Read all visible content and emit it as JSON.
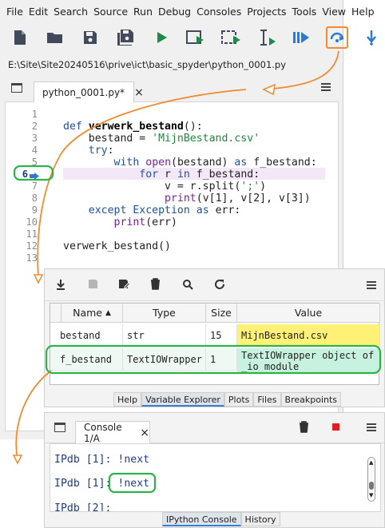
{
  "menubar": {
    "items": [
      "File",
      "Edit",
      "Search",
      "Source",
      "Run",
      "Debug",
      "Consoles",
      "Projects",
      "Tools",
      "View",
      "Help"
    ]
  },
  "toolbar": {
    "icons": [
      "new-file-icon",
      "open-folder-icon",
      "save-icon",
      "save-all-icon",
      "run-icon",
      "run-cell-icon",
      "run-cell-advance-icon",
      "run-selection-icon",
      "debug-icon",
      "step-over-icon",
      "step-into-icon"
    ]
  },
  "path": {
    "text": "E:\\Site\\Site20240516\\prive\\ict\\basic_spyder\\python_0001.py"
  },
  "editor": {
    "tab_label": "python_0001.py*",
    "tab_close": "×",
    "current_line": "6",
    "lines": [
      {
        "n": "1",
        "code": ""
      },
      {
        "n": "2",
        "code": "def verwerk_bestand():"
      },
      {
        "n": "3",
        "code": "    bestand = 'MijnBestand.csv'"
      },
      {
        "n": "4",
        "code": "    try:"
      },
      {
        "n": "5",
        "code": "        with open(bestand) as f_bestand:"
      },
      {
        "n": "6",
        "code": "            for r in f_bestand:"
      },
      {
        "n": "7",
        "code": "                v = r.split(';')"
      },
      {
        "n": "8",
        "code": "                print(v[1], v[2], v[3])"
      },
      {
        "n": "9",
        "code": "    except Exception as err:"
      },
      {
        "n": "10",
        "code": "        print(err)"
      },
      {
        "n": "11",
        "code": ""
      },
      {
        "n": "12",
        "code": "verwerk_bestand()"
      },
      {
        "n": "13",
        "code": ""
      }
    ]
  },
  "variable_explorer": {
    "columns": [
      "Name",
      "Type",
      "Size",
      "Value"
    ],
    "sort_arrow": "▲",
    "rows": [
      {
        "name": "bestand",
        "type": "str",
        "size": "15",
        "value": "MijnBestand.csv",
        "color": "#fff176"
      },
      {
        "name": "f_bestand",
        "type": "TextIOWrapper",
        "size": "1",
        "value": "TextIOWrapper object of _io module",
        "value_l1": "TextIOWrapper object of",
        "value_l2": "_io module",
        "color": "#e8e8e8"
      }
    ],
    "tabs": [
      "Help",
      "Variable Explorer",
      "Plots",
      "Files",
      "Breakpoints"
    ],
    "active_tab": "Variable Explorer"
  },
  "console": {
    "tab_label": "Console 1/A",
    "tab_close": "×",
    "lines": [
      {
        "prompt": "IPdb [1]:",
        "cmd": " !next"
      },
      {
        "prompt": "IPdb [1]:",
        "cmd": " !next"
      },
      {
        "prompt": "IPdb [2]:",
        "cmd": ""
      }
    ],
    "tabs": [
      "IPython Console",
      "History"
    ],
    "active_tab": "IPython Console"
  },
  "colors": {
    "highlight_green": "#2db34a",
    "annotation_orange": "#f28a30",
    "teal_fill": "#c8f2e0",
    "accent_blue": "#2f79d0"
  }
}
